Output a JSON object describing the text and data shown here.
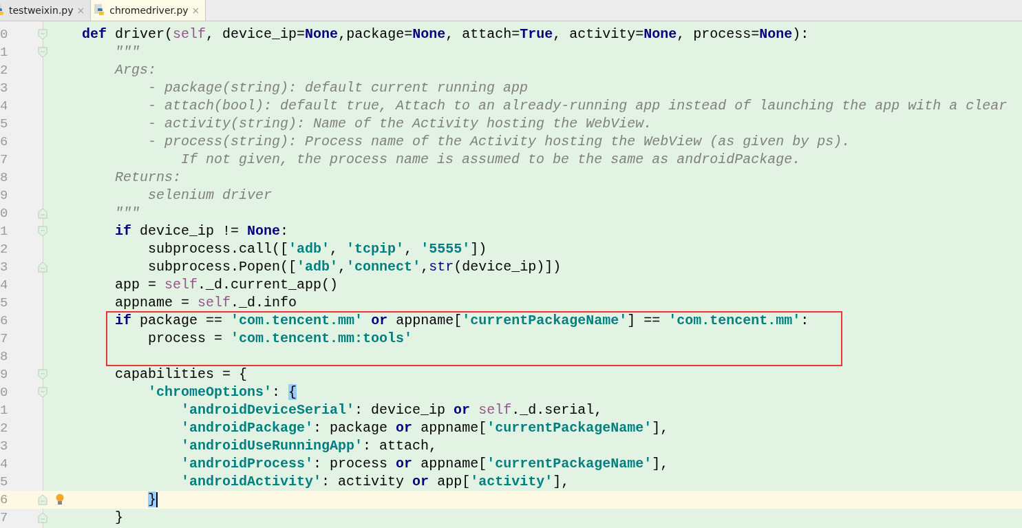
{
  "tabs": [
    {
      "label": "testweixin.py",
      "close": "×",
      "selected": false
    },
    {
      "label": "chromedriver.py",
      "close": "×",
      "selected": true
    }
  ],
  "editor": {
    "lines": [
      {
        "number": "0",
        "fold_start": true,
        "tokens": [
          {
            "kind": "kw",
            "text": "    def"
          },
          {
            "kind": "text",
            "text": " driver("
          },
          {
            "kind": "self",
            "text": "self"
          },
          {
            "kind": "text",
            "text": ", device_ip="
          },
          {
            "kind": "kw",
            "text": "None"
          },
          {
            "kind": "text",
            "text": ",package="
          },
          {
            "kind": "kw",
            "text": "None"
          },
          {
            "kind": "text",
            "text": ", attach="
          },
          {
            "kind": "kw",
            "text": "True"
          },
          {
            "kind": "text",
            "text": ", activity="
          },
          {
            "kind": "kw",
            "text": "None"
          },
          {
            "kind": "text",
            "text": ", process="
          },
          {
            "kind": "kw",
            "text": "None"
          },
          {
            "kind": "text",
            "text": "):"
          }
        ]
      },
      {
        "number": "1",
        "fold_start": true,
        "tokens": [
          {
            "kind": "doc",
            "text": "        \"\"\""
          }
        ]
      },
      {
        "number": "2",
        "tokens": [
          {
            "kind": "doc",
            "text": "        Args:"
          }
        ]
      },
      {
        "number": "3",
        "tokens": [
          {
            "kind": "doc",
            "text": "            - package(string): default current running app"
          }
        ]
      },
      {
        "number": "4",
        "tokens": [
          {
            "kind": "doc",
            "text": "            - attach(bool): default true, Attach to an already-running app instead of launching the app with a clear"
          }
        ]
      },
      {
        "number": "5",
        "tokens": [
          {
            "kind": "doc",
            "text": "            - activity(string): Name of the Activity hosting the WebView."
          }
        ]
      },
      {
        "number": "6",
        "tokens": [
          {
            "kind": "doc",
            "text": "            - process(string): Process name of the Activity hosting the WebView (as given by ps)."
          }
        ]
      },
      {
        "number": "7",
        "tokens": [
          {
            "kind": "doc",
            "text": "                If not given, the process name is assumed to be the same as androidPackage."
          }
        ]
      },
      {
        "number": "8",
        "tokens": [
          {
            "kind": "doc",
            "text": "        Returns:"
          }
        ]
      },
      {
        "number": "9",
        "tokens": [
          {
            "kind": "doc",
            "text": "            selenium driver"
          }
        ]
      },
      {
        "number": "0",
        "fold_end": true,
        "tokens": [
          {
            "kind": "doc",
            "text": "        \"\"\""
          }
        ]
      },
      {
        "number": "1",
        "fold_start": true,
        "tokens": [
          {
            "kind": "kw",
            "text": "        if"
          },
          {
            "kind": "text",
            "text": " device_ip != "
          },
          {
            "kind": "kw",
            "text": "None"
          },
          {
            "kind": "text",
            "text": ":"
          }
        ]
      },
      {
        "number": "2",
        "tokens": [
          {
            "kind": "text",
            "text": "            subprocess.call(["
          },
          {
            "kind": "str",
            "text": "'adb'"
          },
          {
            "kind": "text",
            "text": ", "
          },
          {
            "kind": "str",
            "text": "'tcpip'"
          },
          {
            "kind": "text",
            "text": ", "
          },
          {
            "kind": "str",
            "text": "'5555'"
          },
          {
            "kind": "text",
            "text": "])"
          }
        ]
      },
      {
        "number": "3",
        "fold_end": true,
        "tokens": [
          {
            "kind": "text",
            "text": "            subprocess.Popen(["
          },
          {
            "kind": "str",
            "text": "'adb'"
          },
          {
            "kind": "text",
            "text": ","
          },
          {
            "kind": "str",
            "text": "'connect'"
          },
          {
            "kind": "text",
            "text": ","
          },
          {
            "kind": "builtin",
            "text": "str"
          },
          {
            "kind": "text",
            "text": "(device_ip)])"
          }
        ]
      },
      {
        "number": "4",
        "tokens": [
          {
            "kind": "text",
            "text": "        app = "
          },
          {
            "kind": "self",
            "text": "self"
          },
          {
            "kind": "text",
            "text": "._d.current_app()"
          }
        ]
      },
      {
        "number": "5",
        "tokens": [
          {
            "kind": "text",
            "text": "        appname = "
          },
          {
            "kind": "self",
            "text": "self"
          },
          {
            "kind": "text",
            "text": "._d.info"
          }
        ]
      },
      {
        "number": "6",
        "boxed": true,
        "tokens": [
          {
            "kind": "kw",
            "text": "        if"
          },
          {
            "kind": "text",
            "text": " package == "
          },
          {
            "kind": "str",
            "text": "'com.tencent.mm'"
          },
          {
            "kind": "kw",
            "text": " or"
          },
          {
            "kind": "text",
            "text": " appname["
          },
          {
            "kind": "str",
            "text": "'currentPackageName'"
          },
          {
            "kind": "text",
            "text": "] == "
          },
          {
            "kind": "str",
            "text": "'com.tencent.mm'"
          },
          {
            "kind": "text",
            "text": ":"
          }
        ]
      },
      {
        "number": "7",
        "boxed": true,
        "tokens": [
          {
            "kind": "text",
            "text": "            process = "
          },
          {
            "kind": "str",
            "text": "'com.tencent.mm:tools'"
          }
        ]
      },
      {
        "number": "8",
        "boxed": true
      },
      {
        "number": "9",
        "fold_start": true,
        "tokens": [
          {
            "kind": "text",
            "text": "        capabilities = {"
          }
        ]
      },
      {
        "number": "0",
        "fold_start": true,
        "tokens": [
          {
            "kind": "str",
            "text": "            'chromeOptions'"
          },
          {
            "kind": "text",
            "text": ": "
          },
          {
            "kind": "brace",
            "text": "{"
          }
        ]
      },
      {
        "number": "1",
        "tokens": [
          {
            "kind": "str",
            "text": "                'androidDeviceSerial'"
          },
          {
            "kind": "text",
            "text": ": device_ip "
          },
          {
            "kind": "kw",
            "text": "or"
          },
          {
            "kind": "self",
            "text": " self"
          },
          {
            "kind": "text",
            "text": "._d.serial,"
          }
        ]
      },
      {
        "number": "2",
        "tokens": [
          {
            "kind": "str",
            "text": "                'androidPackage'"
          },
          {
            "kind": "text",
            "text": ": package "
          },
          {
            "kind": "kw",
            "text": "or"
          },
          {
            "kind": "text",
            "text": " appname["
          },
          {
            "kind": "str",
            "text": "'currentPackageName'"
          },
          {
            "kind": "text",
            "text": "],"
          }
        ]
      },
      {
        "number": "3",
        "tokens": [
          {
            "kind": "str",
            "text": "                'androidUseRunningApp'"
          },
          {
            "kind": "text",
            "text": ": attach,"
          }
        ]
      },
      {
        "number": "4",
        "tokens": [
          {
            "kind": "str",
            "text": "                'androidProcess'"
          },
          {
            "kind": "text",
            "text": ": process "
          },
          {
            "kind": "kw",
            "text": "or"
          },
          {
            "kind": "text",
            "text": " appname["
          },
          {
            "kind": "str",
            "text": "'currentPackageName'"
          },
          {
            "kind": "text",
            "text": "],"
          }
        ]
      },
      {
        "number": "5",
        "tokens": [
          {
            "kind": "str",
            "text": "                'androidActivity'"
          },
          {
            "kind": "text",
            "text": ": activity "
          },
          {
            "kind": "kw",
            "text": "or"
          },
          {
            "kind": "text",
            "text": " app["
          },
          {
            "kind": "str",
            "text": "'activity'"
          },
          {
            "kind": "text",
            "text": "],"
          }
        ]
      },
      {
        "number": "6",
        "fold_end": true,
        "current": true,
        "hint": true,
        "tokens": [
          {
            "kind": "brace",
            "text": "            }"
          }
        ]
      },
      {
        "number": "7",
        "fold_end": true,
        "tokens": [
          {
            "kind": "text",
            "text": "        }"
          }
        ]
      }
    ]
  }
}
